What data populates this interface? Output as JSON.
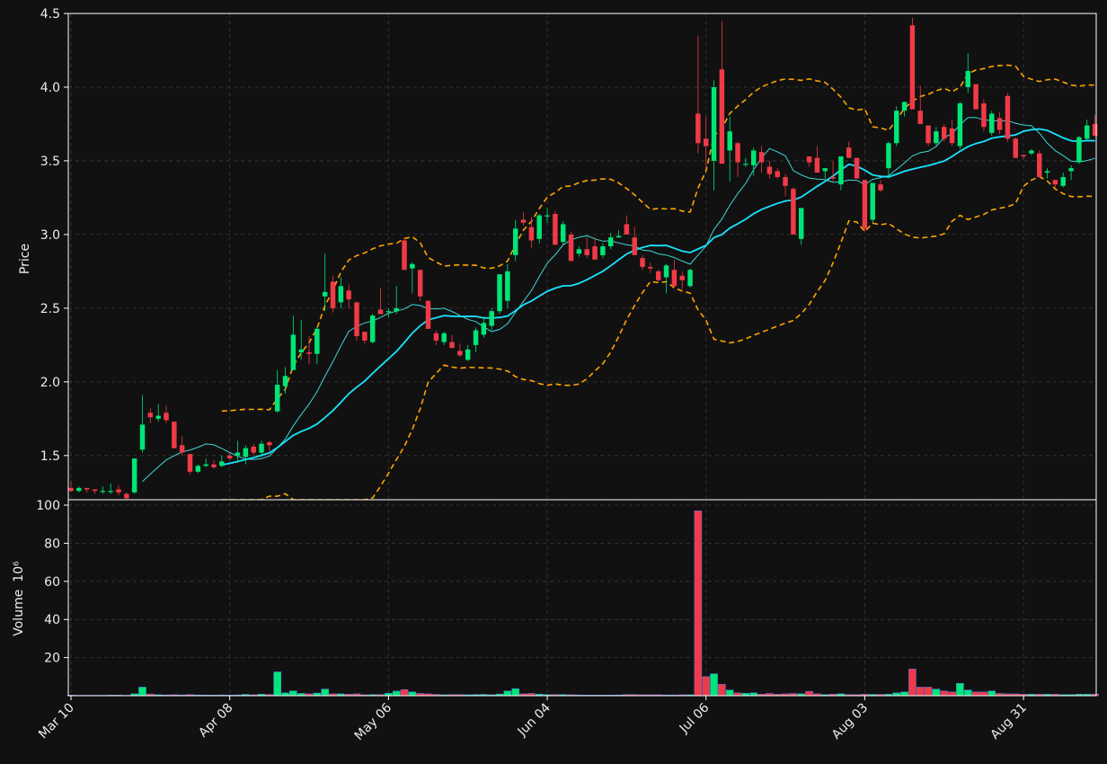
{
  "chart_data": {
    "type": "candlestick",
    "style": {
      "background": "#111111",
      "up_color": "#00e676",
      "down_color": "#f03a47",
      "mav_colors": [
        "#3fd6d6",
        "#18e4ff"
      ],
      "band_color": "#ffa500",
      "grid_color": "#3a3a3a",
      "text_color": "#eeeeee",
      "volume_edge": "#5577ee"
    },
    "price_axis": {
      "label": "Price",
      "ylim": [
        1.2,
        4.5
      ],
      "ticks": [
        1.5,
        2.0,
        2.5,
        3.0,
        3.5,
        4.0,
        4.5
      ],
      "grid": true
    },
    "volume_axis": {
      "label": "Volume",
      "unit": "10⁶",
      "ylim": [
        0,
        100
      ],
      "ticks": [
        20,
        40,
        60,
        80,
        100
      ],
      "grid": true
    },
    "x_ticks": [
      {
        "index": 0,
        "label": "Mar 10"
      },
      {
        "index": 20,
        "label": "Apr 08"
      },
      {
        "index": 40,
        "label": "May 06"
      },
      {
        "index": 60,
        "label": "Jun 04"
      },
      {
        "index": 80,
        "label": "Jul 06"
      },
      {
        "index": 100,
        "label": "Aug 03"
      },
      {
        "index": 120,
        "label": "Aug 31"
      }
    ],
    "ohlcv": [
      [
        1.28,
        1.33,
        1.25,
        1.26,
        0.3
      ],
      [
        1.26,
        1.29,
        1.25,
        1.28,
        0.2
      ],
      [
        1.28,
        1.28,
        1.25,
        1.27,
        0.2
      ],
      [
        1.27,
        1.27,
        1.24,
        1.26,
        0.2
      ],
      [
        1.26,
        1.29,
        1.24,
        1.26,
        0.2
      ],
      [
        1.26,
        1.31,
        1.24,
        1.26,
        0.3
      ],
      [
        1.27,
        1.3,
        1.23,
        1.25,
        0.3
      ],
      [
        1.24,
        1.25,
        1.2,
        1.21,
        0.2
      ],
      [
        1.25,
        1.48,
        1.24,
        1.48,
        1.0
      ],
      [
        1.54,
        1.91,
        1.52,
        1.71,
        4.5
      ],
      [
        1.79,
        1.82,
        1.72,
        1.76,
        0.9
      ],
      [
        1.75,
        1.85,
        1.73,
        1.77,
        0.5
      ],
      [
        1.79,
        1.84,
        1.72,
        1.74,
        0.4
      ],
      [
        1.73,
        1.73,
        1.55,
        1.55,
        0.5
      ],
      [
        1.57,
        1.63,
        1.5,
        1.52,
        0.4
      ],
      [
        1.51,
        1.51,
        1.37,
        1.39,
        0.6
      ],
      [
        1.39,
        1.44,
        1.38,
        1.43,
        0.4
      ],
      [
        1.43,
        1.48,
        1.42,
        1.44,
        0.3
      ],
      [
        1.44,
        1.47,
        1.41,
        1.42,
        0.3
      ],
      [
        1.43,
        1.5,
        1.42,
        1.46,
        0.4
      ],
      [
        1.5,
        1.52,
        1.47,
        1.48,
        0.3
      ],
      [
        1.5,
        1.6,
        1.45,
        1.52,
        0.4
      ],
      [
        1.49,
        1.57,
        1.44,
        1.55,
        0.7
      ],
      [
        1.56,
        1.58,
        1.5,
        1.52,
        0.5
      ],
      [
        1.52,
        1.6,
        1.49,
        1.58,
        0.8
      ],
      [
        1.59,
        1.6,
        1.53,
        1.57,
        0.6
      ],
      [
        1.8,
        2.08,
        1.79,
        1.98,
        12.5
      ],
      [
        1.97,
        2.1,
        1.92,
        2.04,
        1.5
      ],
      [
        2.08,
        2.45,
        2.08,
        2.32,
        2.5
      ],
      [
        2.2,
        2.42,
        2.15,
        2.22,
        1.2
      ],
      [
        2.2,
        2.31,
        2.12,
        2.19,
        1.0
      ],
      [
        2.19,
        2.37,
        2.12,
        2.36,
        1.4
      ],
      [
        2.58,
        2.87,
        2.48,
        2.61,
        3.5
      ],
      [
        2.68,
        2.72,
        2.47,
        2.5,
        1.0
      ],
      [
        2.54,
        2.71,
        2.5,
        2.65,
        1.0
      ],
      [
        2.62,
        2.66,
        2.5,
        2.56,
        0.8
      ],
      [
        2.54,
        2.54,
        2.28,
        2.31,
        1.0
      ],
      [
        2.34,
        2.34,
        2.26,
        2.28,
        0.5
      ],
      [
        2.27,
        2.46,
        2.26,
        2.45,
        0.6
      ],
      [
        2.49,
        2.64,
        2.47,
        2.46,
        0.6
      ],
      [
        2.48,
        2.5,
        2.44,
        2.48,
        1.3
      ],
      [
        2.48,
        2.65,
        2.46,
        2.5,
        2.4
      ],
      [
        2.96,
        2.98,
        2.76,
        2.76,
        3.2
      ],
      [
        2.77,
        2.81,
        2.6,
        2.8,
        2.0
      ],
      [
        2.76,
        2.76,
        2.55,
        2.58,
        1.2
      ],
      [
        2.55,
        2.55,
        2.36,
        2.36,
        1.0
      ],
      [
        2.33,
        2.35,
        2.25,
        2.28,
        0.7
      ],
      [
        2.27,
        2.34,
        2.25,
        2.33,
        0.5
      ],
      [
        2.27,
        2.32,
        2.23,
        2.23,
        0.6
      ],
      [
        2.21,
        2.26,
        2.17,
        2.18,
        0.6
      ],
      [
        2.15,
        2.25,
        2.14,
        2.22,
        0.5
      ],
      [
        2.25,
        2.37,
        2.2,
        2.35,
        0.6
      ],
      [
        2.32,
        2.44,
        2.3,
        2.4,
        0.7
      ],
      [
        2.38,
        2.5,
        2.35,
        2.48,
        0.5
      ],
      [
        2.48,
        2.73,
        2.46,
        2.73,
        0.9
      ],
      [
        2.55,
        2.8,
        2.5,
        2.75,
        2.5
      ],
      [
        2.86,
        3.1,
        2.82,
        3.04,
        3.7
      ],
      [
        3.1,
        3.15,
        3.06,
        3.08,
        1.0
      ],
      [
        3.05,
        3.12,
        2.91,
        2.96,
        1.2
      ],
      [
        2.97,
        3.14,
        2.94,
        3.13,
        0.8
      ],
      [
        3.13,
        3.18,
        3.08,
        3.13,
        0.6
      ],
      [
        3.14,
        3.16,
        2.93,
        2.93,
        0.6
      ],
      [
        2.95,
        3.09,
        2.93,
        3.07,
        0.6
      ],
      [
        3.0,
        3.02,
        2.83,
        2.82,
        0.5
      ],
      [
        2.87,
        2.92,
        2.85,
        2.9,
        0.4
      ],
      [
        2.9,
        2.98,
        2.84,
        2.86,
        0.3
      ],
      [
        2.92,
        2.98,
        2.83,
        2.83,
        0.3
      ],
      [
        2.86,
        2.94,
        2.84,
        2.92,
        0.3
      ],
      [
        2.92,
        3.01,
        2.9,
        2.98,
        0.3
      ],
      [
        2.98,
        3.03,
        2.98,
        2.99,
        0.4
      ],
      [
        3.07,
        3.13,
        3.02,
        3.0,
        0.6
      ],
      [
        2.98,
        3.05,
        2.86,
        2.86,
        0.6
      ],
      [
        2.84,
        2.86,
        2.76,
        2.78,
        0.5
      ],
      [
        2.78,
        2.81,
        2.74,
        2.77,
        0.5
      ],
      [
        2.75,
        2.76,
        2.68,
        2.69,
        0.5
      ],
      [
        2.71,
        2.8,
        2.6,
        2.79,
        0.4
      ],
      [
        2.76,
        2.83,
        2.64,
        2.65,
        0.4
      ],
      [
        2.72,
        2.75,
        2.63,
        2.69,
        0.5
      ],
      [
        2.65,
        2.77,
        2.64,
        2.76,
        0.5
      ],
      [
        3.82,
        4.35,
        3.55,
        3.62,
        97.0
      ],
      [
        3.65,
        3.8,
        3.45,
        3.6,
        10.0
      ],
      [
        3.5,
        4.05,
        3.3,
        4.0,
        11.5
      ],
      [
        4.12,
        4.45,
        3.5,
        3.48,
        6.0
      ],
      [
        3.57,
        3.8,
        3.36,
        3.7,
        3.0
      ],
      [
        3.62,
        3.63,
        3.39,
        3.49,
        1.5
      ],
      [
        3.48,
        3.52,
        3.46,
        3.48,
        1.3
      ],
      [
        3.47,
        3.59,
        3.4,
        3.57,
        1.5
      ],
      [
        3.56,
        3.6,
        3.42,
        3.49,
        0.8
      ],
      [
        3.46,
        3.5,
        3.38,
        3.41,
        1.2
      ],
      [
        3.43,
        3.45,
        3.38,
        3.39,
        0.8
      ],
      [
        3.39,
        3.41,
        3.26,
        3.33,
        1.0
      ],
      [
        3.31,
        3.32,
        3.0,
        3.0,
        1.2
      ],
      [
        2.97,
        3.14,
        2.93,
        3.18,
        1.0
      ],
      [
        3.53,
        3.52,
        3.46,
        3.49,
        2.3
      ],
      [
        3.52,
        3.6,
        3.43,
        3.42,
        1.0
      ],
      [
        3.43,
        3.45,
        3.38,
        3.45,
        0.6
      ],
      [
        3.39,
        3.5,
        3.36,
        3.38,
        0.8
      ],
      [
        3.34,
        3.52,
        3.3,
        3.53,
        1.0
      ],
      [
        3.59,
        3.63,
        3.52,
        3.52,
        0.6
      ],
      [
        3.52,
        3.52,
        3.38,
        3.38,
        0.6
      ],
      [
        3.37,
        3.37,
        3.02,
        3.04,
        0.8
      ],
      [
        3.1,
        3.35,
        3.08,
        3.35,
        0.7
      ],
      [
        3.34,
        3.37,
        3.29,
        3.3,
        0.7
      ],
      [
        3.45,
        3.63,
        3.38,
        3.62,
        0.8
      ],
      [
        3.62,
        3.87,
        3.6,
        3.84,
        1.5
      ],
      [
        3.84,
        3.9,
        3.8,
        3.9,
        2.0
      ],
      [
        4.42,
        4.47,
        3.85,
        3.85,
        14.0
      ],
      [
        3.84,
        4.01,
        3.75,
        3.75,
        4.5
      ],
      [
        3.74,
        3.74,
        3.6,
        3.62,
        4.5
      ],
      [
        3.62,
        3.73,
        3.6,
        3.7,
        3.5
      ],
      [
        3.73,
        3.75,
        3.63,
        3.65,
        2.5
      ],
      [
        3.72,
        3.78,
        3.6,
        3.62,
        2.0
      ],
      [
        3.6,
        3.9,
        3.58,
        3.89,
        6.5
      ],
      [
        4.0,
        4.23,
        3.96,
        4.11,
        3.0
      ],
      [
        4.02,
        4.02,
        3.85,
        3.85,
        2.0
      ],
      [
        3.89,
        3.92,
        3.7,
        3.73,
        2.0
      ],
      [
        3.69,
        3.84,
        3.67,
        3.82,
        2.5
      ],
      [
        3.79,
        3.83,
        3.68,
        3.71,
        1.2
      ],
      [
        3.94,
        3.96,
        3.63,
        3.65,
        1.0
      ],
      [
        3.65,
        3.66,
        3.52,
        3.52,
        1.0
      ],
      [
        3.54,
        3.54,
        3.51,
        3.53,
        0.8
      ],
      [
        3.55,
        3.58,
        3.54,
        3.57,
        0.8
      ],
      [
        3.55,
        3.57,
        3.39,
        3.39,
        0.8
      ],
      [
        3.42,
        3.45,
        3.38,
        3.43,
        0.8
      ],
      [
        3.37,
        3.37,
        3.32,
        3.34,
        0.8
      ],
      [
        3.33,
        3.42,
        3.32,
        3.39,
        0.6
      ],
      [
        3.43,
        3.47,
        3.37,
        3.45,
        0.6
      ],
      [
        3.49,
        3.67,
        3.48,
        3.66,
        0.8
      ],
      [
        3.65,
        3.78,
        3.64,
        3.74,
        0.8
      ],
      [
        3.75,
        3.81,
        3.67,
        3.67,
        0.8
      ]
    ]
  }
}
